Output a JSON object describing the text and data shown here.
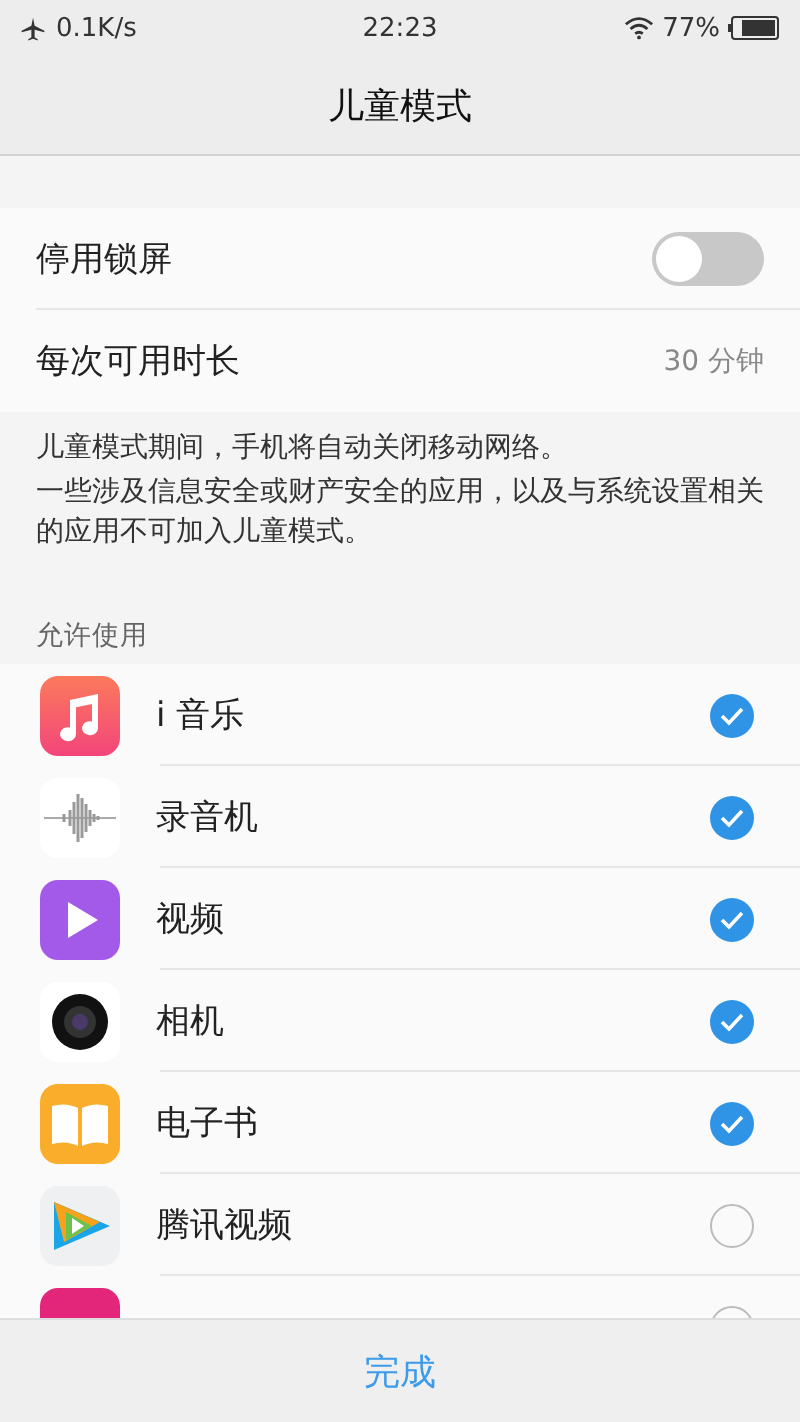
{
  "status_bar": {
    "speed": "0.1K/s",
    "time": "22:23",
    "battery": "77%"
  },
  "header": {
    "title": "儿童模式"
  },
  "settings": [
    {
      "kind": "toggle",
      "label": "停用锁屏",
      "on": false
    },
    {
      "kind": "value",
      "label": "每次可用时长",
      "value": "30 分钟"
    }
  ],
  "note": [
    "儿童模式期间，手机将自动关闭移动网络。",
    "一些涉及信息安全或财产安全的应用，以及与系统设置相关的应用不可加入儿童模式。"
  ],
  "section_title": "允许使用",
  "apps": [
    {
      "kind": "music",
      "name": "i 音乐",
      "checked": true
    },
    {
      "kind": "recorder",
      "name": "录音机",
      "checked": true
    },
    {
      "kind": "video",
      "name": "视频",
      "checked": true
    },
    {
      "kind": "camera",
      "name": "相机",
      "checked": true
    },
    {
      "kind": "book",
      "name": "电子书",
      "checked": true
    },
    {
      "kind": "tencent",
      "name": "腾讯视频",
      "checked": false
    },
    {
      "kind": "shop",
      "checked": false
    }
  ],
  "footer": {
    "button": "完成"
  }
}
